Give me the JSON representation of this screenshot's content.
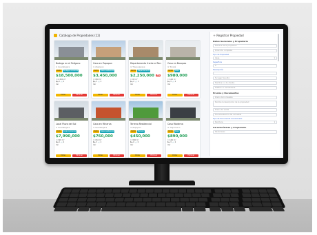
{
  "page": {
    "title": "Catálogo de Propiedades (12)"
  },
  "cards": [
    {
      "title": "Bodega en el Polígono",
      "location": "Guadalajara",
      "badges": [
        "Venta",
        "Bodega comercial"
      ],
      "price": "$18,500,000",
      "discount": "",
      "meta": [
        "☐ 2,500 m²",
        "🛏 0  🛁 2",
        "Ver"
      ],
      "edit": "Editar",
      "delete": "Eliminar",
      "colors": {
        "sky": "#c8d4e0",
        "bld": "#8a8f96"
      }
    },
    {
      "title": "Casa en Zapopan",
      "location": "Zapopan",
      "badges": [
        "Venta",
        "Casa residencial"
      ],
      "price": "$3,450,000",
      "discount": "",
      "meta": [
        "☐ 180 m²",
        "🛏 3  🛁 2",
        "Ver"
      ],
      "edit": "Editar",
      "delete": "Eliminar",
      "colors": {
        "sky": "#b9cfe6",
        "bld": "#c6a07a"
      }
    },
    {
      "title": "Departamento frente al Parque",
      "location": "Tlaquepaque",
      "badges": [
        "Renta",
        "Departamento"
      ],
      "price": "$2,250,000",
      "discount": "-5%",
      "meta": [
        "☐ 95 m²",
        "🛏 2  🛁 1",
        "Ver"
      ],
      "edit": "Editar",
      "delete": "Eliminar",
      "colors": {
        "sky": "#dfe6ea",
        "bld": "#a88a6a"
      }
    },
    {
      "title": "Casa en Bosques",
      "location": "Tonalá",
      "badges": [
        "Venta",
        "Casa"
      ],
      "price": "$980,000",
      "discount": "",
      "meta": [
        "☐ 120 m²",
        "🛏 3  🛁 2",
        "Ver"
      ],
      "edit": "Editar",
      "delete": "Eliminar",
      "colors": {
        "sky": "#e8ecef",
        "bld": "#b9b3a8"
      }
    },
    {
      "title": "Local Plaza del Sol",
      "location": "Guadalajara",
      "badges": [
        "Venta",
        "Local comercial"
      ],
      "price": "$7,990,000",
      "discount": "",
      "meta": [
        "☐ 320 m²",
        "🛏 0  🛁 2",
        "Ver"
      ],
      "edit": "Editar",
      "delete": "Eliminar",
      "colors": {
        "sky": "#d3dbe2",
        "bld": "#5c5f63"
      }
    },
    {
      "title": "Casa en Minerva",
      "location": "Guadalajara",
      "badges": [
        "Venta",
        "Casa residencial"
      ],
      "price": "$760,000",
      "discount": "",
      "meta": [
        "☐ 150 m²",
        "🛏 3  🛁 2",
        "Ver"
      ],
      "edit": "Editar",
      "delete": "Eliminar",
      "colors": {
        "sky": "#bcd2e8",
        "bld": "#c5532e"
      }
    },
    {
      "title": "Terreno Residencial",
      "location": "Zapopan",
      "badges": [
        "Venta",
        "Terreno"
      ],
      "price": "$450,000",
      "discount": "",
      "meta": [
        "☐ 300 m²",
        "🛏 0  🛁 0",
        "Ver"
      ],
      "edit": "Editar",
      "delete": "Eliminar",
      "colors": {
        "sky": "#9fc3e0",
        "bld": "#4f9a3c"
      }
    },
    {
      "title": "Casa Moderna",
      "location": "Tlajomulco",
      "badges": [
        "Venta",
        "Casa"
      ],
      "price": "$890,000",
      "discount": "",
      "meta": [
        "☐ 140 m²",
        "🛏 3  🛁 2",
        "Ver"
      ],
      "edit": "Editar",
      "delete": "Eliminar",
      "colors": {
        "sky": "#d9dfe4",
        "bld": "#3b3f44"
      }
    }
  ],
  "form": {
    "title": "Registrar Propiedad",
    "sections": [
      "Datos Generales y Propietario",
      "Precios y Documentos",
      "Características y Propietario"
    ],
    "fields": [
      {
        "label": "",
        "value": "Nombre de la propiedad"
      },
      {
        "label": "",
        "value": "Dirección completa"
      },
      {
        "label": "Tipo de Propiedad",
        "value": "Casa"
      },
      {
        "label": "Superficie",
        "value": "0"
      },
      {
        "label": "Descripción",
        "value": ""
      },
      {
        "label": "",
        "value": "Tu lugar favorito"
      },
      {
        "label": "",
        "value": "Nombre o a tu cliente"
      },
      {
        "label": "",
        "value": "Teléfono o Inmobiliaria"
      },
      {
        "label": "",
        "value": "Precio del inmueble"
      },
      {
        "label": "",
        "value": "Escribe la descripción de la propiedad"
      },
      {
        "label": "",
        "value": "Precio de venta"
      },
      {
        "label": "",
        "value": "Documentación del inmueble"
      },
      {
        "label": "Tipo de Documento Corroborado",
        "value": "Escritura"
      },
      {
        "label": "",
        "value": "Recámaras"
      }
    ]
  }
}
